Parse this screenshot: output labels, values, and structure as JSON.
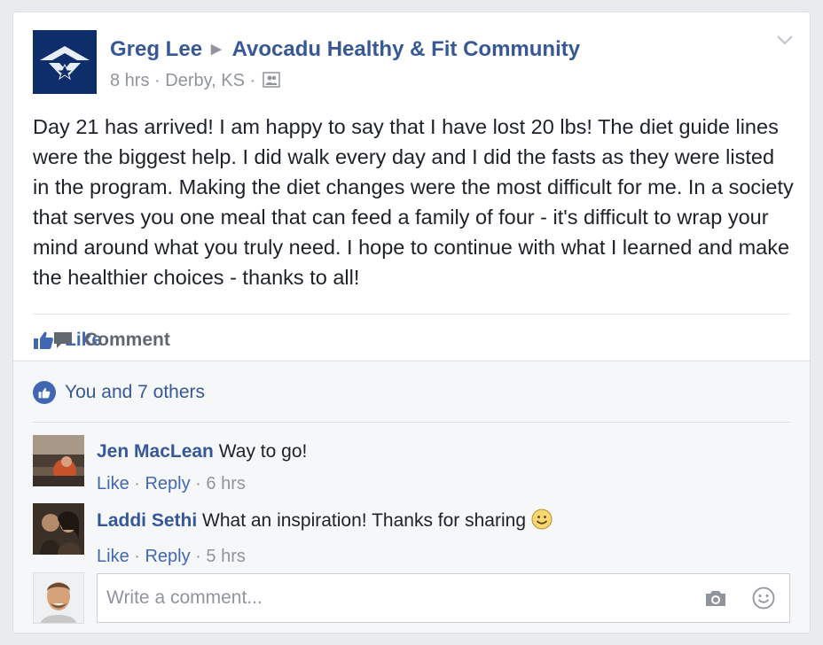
{
  "post": {
    "author": "Greg Lee",
    "group": "Avocadu Healthy & Fit Community",
    "time": "8 hrs",
    "location": "Derby, KS",
    "audience_icon": "group-audience-icon",
    "text": "Day 21 has arrived! I am happy to say that I have lost 20 lbs! The diet guide lines were the biggest help. I did walk every day and I did the fasts as they were listed in the program. Making the diet changes were the most difficult for me. In a society that serves you one meal that can feed a family of four - it's difficult to wrap your mind around what you truly need. I hope to continue with what I learned and make the healthier choices - thanks to all!"
  },
  "actions": {
    "like": "Like",
    "comment": "Comment"
  },
  "likes": {
    "summary": "You and 7 others"
  },
  "comments": [
    {
      "author": "Jen MacLean",
      "text": "Way to go!",
      "like": "Like",
      "reply": "Reply",
      "time": "6 hrs"
    },
    {
      "author": "Laddi Sethi",
      "text": "What an inspiration! Thanks for sharing",
      "like": "Like",
      "reply": "Reply",
      "time": "5 hrs"
    }
  ],
  "composer": {
    "placeholder": "Write a comment..."
  },
  "colors": {
    "link": "#365899",
    "accent": "#4267b2",
    "meta": "#90949c",
    "text": "#1d2129",
    "background": "#e9ebee"
  }
}
